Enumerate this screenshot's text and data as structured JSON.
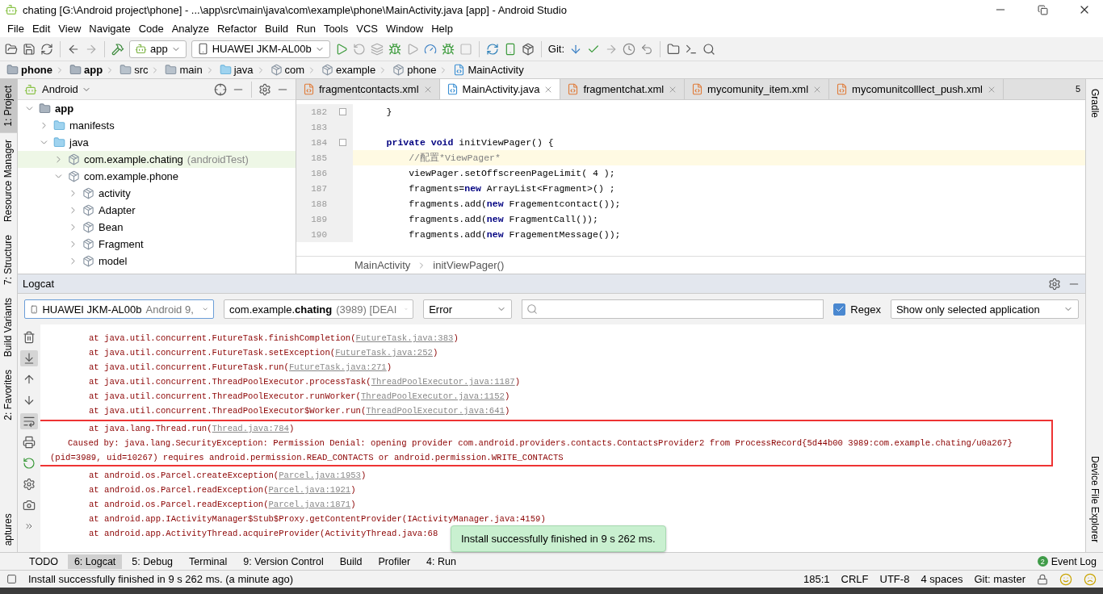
{
  "window": {
    "title": "chating [G:\\Android project\\phone] - ...\\app\\src\\main\\java\\com\\example\\phone\\MainActivity.java [app] - Android Studio"
  },
  "menu": [
    "File",
    "Edit",
    "View",
    "Navigate",
    "Code",
    "Analyze",
    "Refactor",
    "Build",
    "Run",
    "Tools",
    "VCS",
    "Window",
    "Help"
  ],
  "toolbar": {
    "run_config": "app",
    "device": "HUAWEI JKM-AL00b",
    "git_label": "Git:"
  },
  "nav_bar": [
    {
      "label": "phone",
      "kind": "module"
    },
    {
      "label": "app",
      "kind": "module"
    },
    {
      "label": "src",
      "kind": "folder"
    },
    {
      "label": "main",
      "kind": "folder"
    },
    {
      "label": "java",
      "kind": "source"
    },
    {
      "label": "com",
      "kind": "package"
    },
    {
      "label": "example",
      "kind": "package"
    },
    {
      "label": "phone",
      "kind": "package"
    },
    {
      "label": "MainActivity",
      "kind": "class"
    }
  ],
  "left_strip": [
    {
      "label": "1: Project",
      "selected": true
    },
    {
      "label": "Resource Manager",
      "selected": false
    },
    {
      "label": "7: Structure",
      "selected": false
    },
    {
      "label": "Build Variants",
      "selected": false
    },
    {
      "label": "2: Favorites",
      "selected": false
    },
    {
      "label": "aptures",
      "selected": false
    }
  ],
  "right_strip": [
    "Gradle",
    "Device File Explorer"
  ],
  "project": {
    "view": "Android",
    "tree": [
      {
        "label": "app",
        "kind": "module",
        "expanded": true,
        "selected": false,
        "children": [
          {
            "label": "manifests",
            "kind": "source",
            "expanded": false,
            "selected": false
          },
          {
            "label": "java",
            "kind": "source",
            "expanded": true,
            "selected": false,
            "children": [
              {
                "label": "com.example.chating",
                "note": "(androidTest)",
                "kind": "package",
                "expanded": false,
                "selected": true
              },
              {
                "label": "com.example.phone",
                "kind": "package",
                "expanded": true,
                "selected": false,
                "children": [
                  {
                    "label": "activity",
                    "kind": "package",
                    "expanded": false,
                    "selected": false
                  },
                  {
                    "label": "Adapter",
                    "kind": "package",
                    "expanded": false,
                    "selected": false
                  },
                  {
                    "label": "Bean",
                    "kind": "package",
                    "expanded": false,
                    "selected": false
                  },
                  {
                    "label": "Fragment",
                    "kind": "package",
                    "expanded": false,
                    "selected": false
                  },
                  {
                    "label": "model",
                    "kind": "package",
                    "expanded": false,
                    "selected": false
                  }
                ]
              }
            ]
          }
        ]
      }
    ]
  },
  "editor": {
    "tabs": [
      {
        "label": "fragmentcontacts.xml",
        "kind": "xml",
        "selected": false
      },
      {
        "label": "MainActivity.java",
        "kind": "java",
        "selected": true
      },
      {
        "label": "fragmentchat.xml",
        "kind": "xml",
        "selected": false
      },
      {
        "label": "mycomunity_item.xml",
        "kind": "xml",
        "selected": false
      },
      {
        "label": "mycomunitcolllect_push.xml",
        "kind": "xml",
        "selected": false
      }
    ],
    "overflow": "5",
    "lines": [
      {
        "number": "182",
        "code": "    }",
        "fold": true,
        "current": false,
        "kind": "code"
      },
      {
        "number": "183",
        "fold": false,
        "current": false,
        "kind": "code"
      },
      {
        "number": "184",
        "code": "    **private void** initViewPager() {",
        "fold": true,
        "current": false,
        "kind": "code"
      },
      {
        "number": "185",
        "code": "        //配置*ViewPager*",
        "fold": false,
        "current": true,
        "kind": "comment"
      },
      {
        "number": "186",
        "code": "        viewPager.setOffscreenPageLimit( 4 );",
        "fold": false,
        "current": false,
        "kind": "code"
      },
      {
        "number": "187",
        "code": "        fragments=**new** ArrayList<Fragment>() ;",
        "fold": false,
        "current": false,
        "kind": "code"
      },
      {
        "number": "188",
        "code": "        fragments.add(**new** Fragementcontact());",
        "fold": false,
        "current": false,
        "kind": "code"
      },
      {
        "number": "189",
        "code": "        fragments.add(**new** FragmentCall());",
        "fold": false,
        "current": false,
        "kind": "code"
      },
      {
        "number": "190",
        "code": "        fragments.add(**new** FragementMessage());",
        "fold": false,
        "current": false,
        "kind": "code"
      }
    ],
    "breadcrumb": [
      "MainActivity",
      "initViewPager()"
    ]
  },
  "logcat": {
    "title": "Logcat",
    "device": {
      "name": "HUAWEI JKM-AL00b",
      "detail": "Android 9,"
    },
    "process": {
      "prefix": "com.example.",
      "name": "chating",
      "detail": "(3989) [DEAI"
    },
    "level": "Error",
    "regex": {
      "label": "Regex",
      "checked": true
    },
    "filter": "Show only selected application",
    "blocks": [
      {
        "highlighted": false,
        "lines": [
          {
            "kind": "frame",
            "prefix": "at java.util.concurrent.FutureTask.finishCompletion(",
            "link": "FutureTask.java:383",
            "suffix": ")"
          },
          {
            "kind": "frame",
            "prefix": "at java.util.concurrent.FutureTask.setException(",
            "link": "FutureTask.java:252",
            "suffix": ")"
          },
          {
            "kind": "frame",
            "prefix": "at java.util.concurrent.FutureTask.run(",
            "link": "FutureTask.java:271",
            "suffix": ")"
          },
          {
            "kind": "frame",
            "prefix": "at java.util.concurrent.ThreadPoolExecutor.processTask(",
            "link": "ThreadPoolExecutor.java:1187",
            "suffix": ")"
          },
          {
            "kind": "frame",
            "prefix": "at java.util.concurrent.ThreadPoolExecutor.runWorker(",
            "link": "ThreadPoolExecutor.java:1152",
            "suffix": ")"
          },
          {
            "kind": "frame",
            "prefix": "at java.util.concurrent.ThreadPoolExecutor$Worker.run(",
            "link": "ThreadPoolExecutor.java:641",
            "suffix": ")"
          }
        ]
      },
      {
        "highlighted": true,
        "lines": [
          {
            "kind": "frame",
            "prefix": "at java.lang.Thread.run(",
            "link": "Thread.java:784",
            "suffix": ")"
          },
          {
            "kind": "cause",
            "prefix": "Caused by: java.lang.SecurityException: Permission Denial: opening provider com.android.providers.contacts.ContactsProvider2 from ProcessRecord{5d44b00 3989:com.example.chating/u0a267} (pid=3989, uid=10267) requires android.permission.READ_CONTACTS or android.permission.WRITE_CONTACTS"
          }
        ]
      },
      {
        "highlighted": false,
        "lines": [
          {
            "kind": "frame",
            "prefix": "at android.os.Parcel.createException(",
            "link": "Parcel.java:1953",
            "suffix": ")"
          },
          {
            "kind": "frame",
            "prefix": "at android.os.Parcel.readException(",
            "link": "Parcel.java:1921",
            "suffix": ")"
          },
          {
            "kind": "frame",
            "prefix": "at android.os.Parcel.readException(",
            "link": "Parcel.java:1871",
            "suffix": ")"
          },
          {
            "kind": "frame",
            "prefix": "at android.app.IActivityManager$Stub$Proxy.getContentProvider(IActivityManager.java:4159)"
          },
          {
            "kind": "frame",
            "prefix": "at android.app.ActivityThread.acquireProvider(ActivityThread.java:68"
          }
        ]
      }
    ]
  },
  "toast": "Install successfully finished in 9 s 262 ms.",
  "tool_tabs": [
    {
      "label": "TODO",
      "selected": false
    },
    {
      "label": "6: Logcat",
      "selected": true
    },
    {
      "label": "5: Debug",
      "selected": false
    },
    {
      "label": "Terminal",
      "selected": false
    },
    {
      "label": "9: Version Control",
      "selected": false
    },
    {
      "label": "Build",
      "selected": false
    },
    {
      "label": "Profiler",
      "selected": false
    },
    {
      "label": "4: Run",
      "selected": false
    }
  ],
  "event_log": {
    "label": "Event Log",
    "count": "2"
  },
  "status_bar": {
    "message": "Install successfully finished in 9 s 262 ms. (a minute ago)",
    "position": "185:1",
    "line_ending": "CRLF",
    "encoding": "UTF-8",
    "indent": "4 spaces",
    "branch": "Git: master"
  }
}
